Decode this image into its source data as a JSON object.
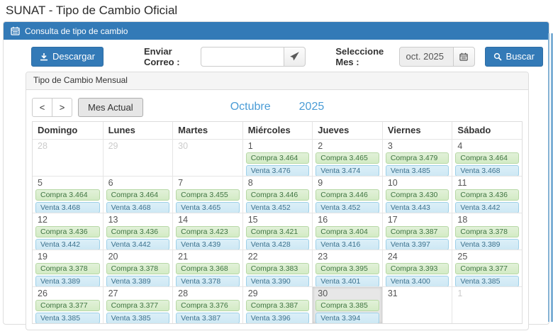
{
  "page": {
    "title": "SUNAT - Tipo de Cambio Oficial"
  },
  "header": {
    "title": "Consulta de tipo de cambio",
    "icon": "calendar-icon"
  },
  "toolbar": {
    "download": "Descargar",
    "email_label": "Enviar Correo :",
    "email_value": "",
    "month_label": "Seleccione Mes :",
    "month_value": "oct. 2025",
    "search": "Buscar"
  },
  "calendar": {
    "panel_title": "Tipo de Cambio Mensual",
    "prev": "<",
    "next": ">",
    "current_month": "Mes Actual",
    "month": "Octubre",
    "year": "2025",
    "day_headers": [
      "Domingo",
      "Lunes",
      "Martes",
      "Miércoles",
      "Jueves",
      "Viernes",
      "Sábado"
    ],
    "buy_prefix": "Compra",
    "sell_prefix": "Venta",
    "days": [
      {
        "label": "28",
        "muted": true
      },
      {
        "label": "29",
        "muted": true
      },
      {
        "label": "30",
        "muted": true
      },
      {
        "label": "1",
        "compra": "3.464",
        "venta": "3.476"
      },
      {
        "label": "2",
        "compra": "3.465",
        "venta": "3.474"
      },
      {
        "label": "3",
        "compra": "3.479",
        "venta": "3.485"
      },
      {
        "label": "4",
        "compra": "3.464",
        "venta": "3.468"
      },
      {
        "label": "5",
        "compra": "3.464",
        "venta": "3.468"
      },
      {
        "label": "6",
        "compra": "3.464",
        "venta": "3.468"
      },
      {
        "label": "7",
        "compra": "3.455",
        "venta": "3.465"
      },
      {
        "label": "8",
        "compra": "3.446",
        "venta": "3.452"
      },
      {
        "label": "9",
        "compra": "3.446",
        "venta": "3.452"
      },
      {
        "label": "10",
        "compra": "3.430",
        "venta": "3.443"
      },
      {
        "label": "11",
        "compra": "3.436",
        "venta": "3.442"
      },
      {
        "label": "12",
        "compra": "3.436",
        "venta": "3.442"
      },
      {
        "label": "13",
        "compra": "3.436",
        "venta": "3.442"
      },
      {
        "label": "14",
        "compra": "3.423",
        "venta": "3.439"
      },
      {
        "label": "15",
        "compra": "3.421",
        "venta": "3.428"
      },
      {
        "label": "16",
        "compra": "3.404",
        "venta": "3.416"
      },
      {
        "label": "17",
        "compra": "3.387",
        "venta": "3.397"
      },
      {
        "label": "18",
        "compra": "3.378",
        "venta": "3.389"
      },
      {
        "label": "19",
        "compra": "3.378",
        "venta": "3.389"
      },
      {
        "label": "20",
        "compra": "3.378",
        "venta": "3.389"
      },
      {
        "label": "21",
        "compra": "3.368",
        "venta": "3.378"
      },
      {
        "label": "22",
        "compra": "3.383",
        "venta": "3.390"
      },
      {
        "label": "23",
        "compra": "3.395",
        "venta": "3.401"
      },
      {
        "label": "24",
        "compra": "3.393",
        "venta": "3.400"
      },
      {
        "label": "25",
        "compra": "3.377",
        "venta": "3.385"
      },
      {
        "label": "26",
        "compra": "3.377",
        "venta": "3.385"
      },
      {
        "label": "27",
        "compra": "3.377",
        "venta": "3.385"
      },
      {
        "label": "28",
        "compra": "3.376",
        "venta": "3.387"
      },
      {
        "label": "29",
        "compra": "3.387",
        "venta": "3.396"
      },
      {
        "label": "30",
        "compra": "3.385",
        "venta": "3.394",
        "today": true
      },
      {
        "label": "31"
      },
      {
        "label": "1",
        "muted": true
      }
    ]
  },
  "colors": {
    "accent": "#337ab7",
    "buy_bg": "#dff0d8",
    "buy_text": "#3c763d",
    "sell_bg": "#d9edf7",
    "sell_text": "#31708f",
    "month_title": "#4a9cd6",
    "today_bg": "#e7e7e7"
  }
}
